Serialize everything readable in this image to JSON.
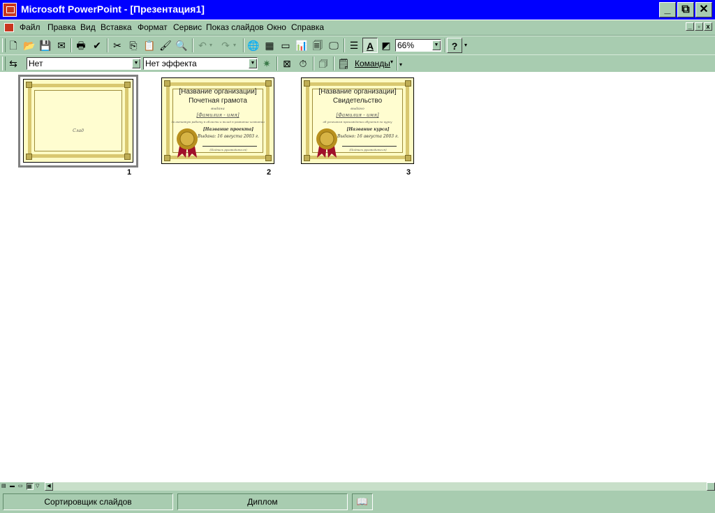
{
  "window": {
    "title": "Microsoft PowerPoint - [Презентация1]"
  },
  "menu": {
    "items": [
      "Файл",
      "Правка",
      "Вид",
      "Вставка",
      "Формат",
      "Сервис",
      "Показ слайдов",
      "Окно",
      "Справка"
    ]
  },
  "standard_toolbar": {
    "zoom_value": "66%"
  },
  "sorter_toolbar": {
    "transition_value": "Нет",
    "effect_value": "Нет эффекта",
    "commands_label": "Команды"
  },
  "slides": [
    {
      "number": "1",
      "text": "Слад"
    },
    {
      "number": "2",
      "org": "[Название организации]",
      "title": "Почетная грамота",
      "issued": "выдана",
      "name": "[Фамилия - имя]",
      "reason": "За активную работу в области и вклад в развитие компании",
      "course": "[Название проекта]",
      "date": "Выдана: 16 августа 2003 г.",
      "sign": "(Подпись руководителя)"
    },
    {
      "number": "3",
      "org": "[Название организации]",
      "title": "Свидетельство",
      "issued": "выдано",
      "name": "[Фамилия - имя]",
      "reason": "об успешном прохождении обучения по курсу",
      "course": "[Название курса]",
      "date": "Выдано: 16 августа 2003 г.",
      "sign": "(Подпись руководителя)"
    }
  ],
  "status": {
    "view_label": "Сортировщик слайдов",
    "template_label": "Диплом"
  },
  "colors": {
    "title_bar": "#0000ff",
    "chrome": "#a8ccb0",
    "slide_bg": "#fdfbc4",
    "frame": "#d9c870",
    "seal": "#b8901e",
    "ribbon": "#a0102a"
  }
}
